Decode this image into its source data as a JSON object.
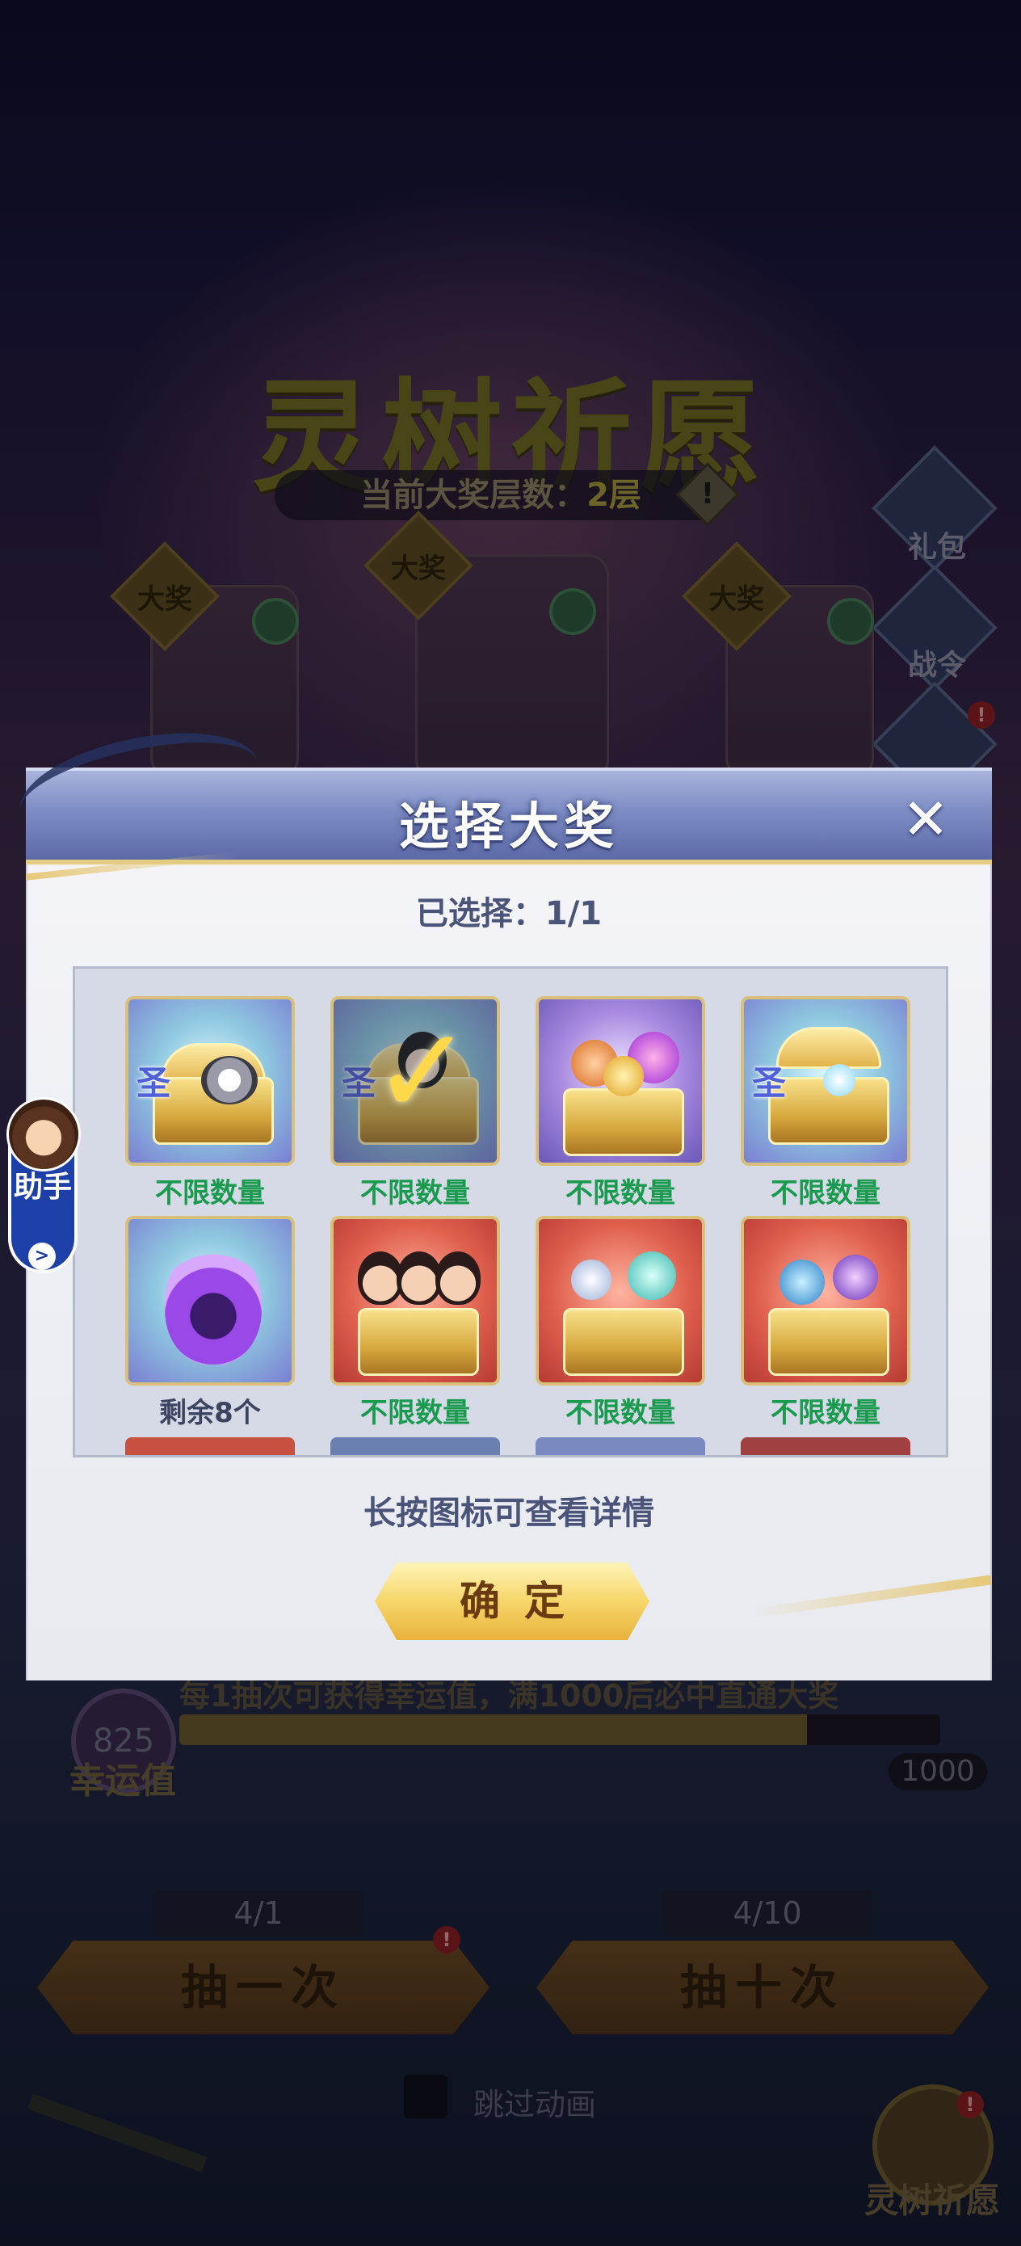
{
  "background": {
    "event_title": "灵树祈愿",
    "layer_label": "当前大奖层数：",
    "layer_value": "2层",
    "warning_symbol": "!",
    "side_buttons": [
      {
        "label": "礼包",
        "icon": "gift-icon"
      },
      {
        "label": "战令",
        "icon": "battle-pass-icon"
      },
      {
        "label": "",
        "icon": "shop-icon"
      }
    ],
    "prize_badge": "大奖",
    "luck": {
      "value": "825",
      "label": "幸运值",
      "hint": "每1抽次可获得幸运值，满1000后必中直通大奖",
      "max": "1000",
      "progress": 0.825
    },
    "draw_one": {
      "count": "4/1",
      "label": "抽一次",
      "badge": "!"
    },
    "draw_ten": {
      "count": "4/10",
      "label": "抽十次"
    },
    "skip_animation": "跳过动画",
    "bottom_button": {
      "label": "灵树祈愿",
      "badge": "!"
    }
  },
  "assistant": {
    "label": "助手",
    "go": ">"
  },
  "dialog": {
    "title": "选择大奖",
    "close_symbol": "✕",
    "selected_label": "已选择：1/1",
    "items": [
      {
        "caption": "不限数量",
        "caption_color": "#1a9a4e",
        "icon": "saint-chest-tiger-icon",
        "selected": false
      },
      {
        "caption": "不限数量",
        "caption_color": "#1a9a4e",
        "icon": "saint-chest-selected-icon",
        "selected": true
      },
      {
        "caption": "不限数量",
        "caption_color": "#1a9a4e",
        "icon": "orb-chest-icon",
        "selected": false
      },
      {
        "caption": "不限数量",
        "caption_color": "#1a9a4e",
        "icon": "saint-chest-open-icon",
        "selected": false
      },
      {
        "caption": "剩余8个",
        "caption_color": "#3c4560",
        "icon": "purple-flame-icon",
        "selected": false
      },
      {
        "caption": "不限数量",
        "caption_color": "#1a9a4e",
        "icon": "hero-chest-icon",
        "selected": false
      },
      {
        "caption": "不限数量",
        "caption_color": "#1a9a4e",
        "icon": "jewel-chest-icon",
        "selected": false
      },
      {
        "caption": "不限数量",
        "caption_color": "#1a9a4e",
        "icon": "gem-chest-icon",
        "selected": false
      }
    ],
    "hint": "长按图标可查看详情",
    "confirm_label": "确定"
  }
}
